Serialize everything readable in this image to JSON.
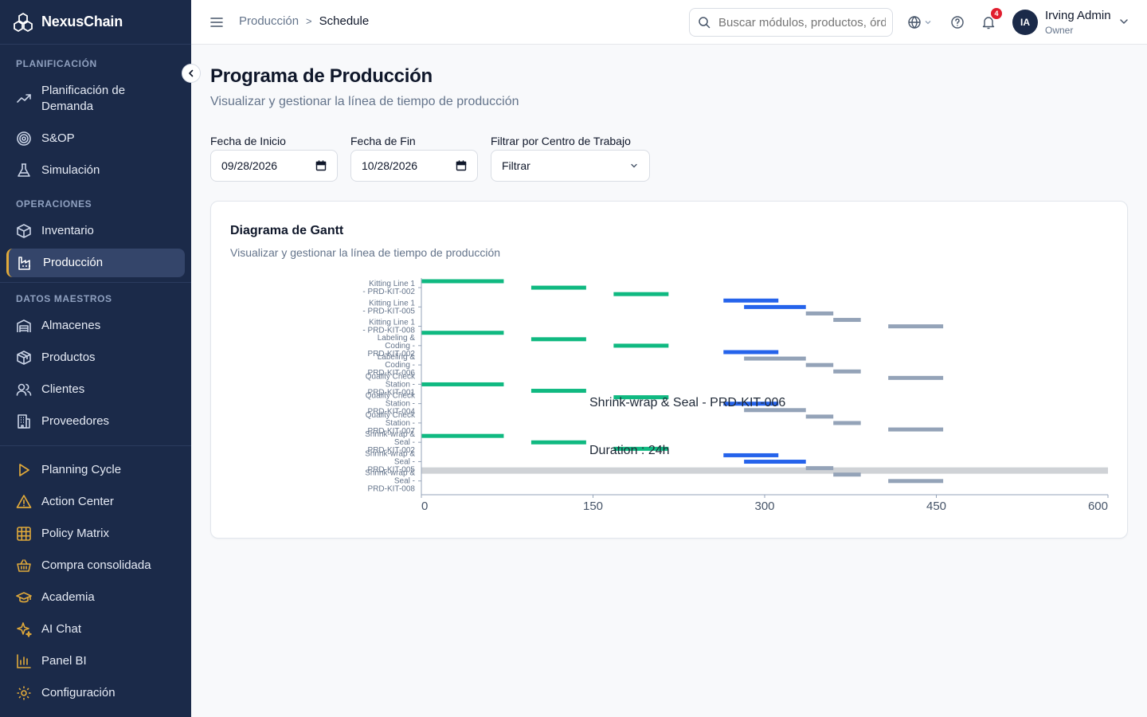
{
  "brand": {
    "name": "NexusChain"
  },
  "sidebar": {
    "sections": {
      "planning": "PLANIFICACIÓN",
      "operations": "OPERACIONES",
      "master_data": "DATOS MAESTROS"
    },
    "items": [
      {
        "label": "Planificación de Demanda",
        "icon": "trend-up-icon"
      },
      {
        "label": "S&OP",
        "icon": "target-icon"
      },
      {
        "label": "Simulación",
        "icon": "flask-icon"
      },
      {
        "label": "Inventario",
        "icon": "box-icon"
      },
      {
        "label": "Producción",
        "icon": "factory-icon",
        "active": true
      },
      {
        "label": "Almacenes",
        "icon": "warehouse-icon"
      },
      {
        "label": "Productos",
        "icon": "package-icon"
      },
      {
        "label": "Clientes",
        "icon": "users-icon"
      },
      {
        "label": "Proveedores",
        "icon": "building-icon"
      },
      {
        "label": "Planning Cycle",
        "icon": "play-icon"
      },
      {
        "label": "Action Center",
        "icon": "alert-triangle-icon"
      },
      {
        "label": "Policy Matrix",
        "icon": "grid-icon"
      },
      {
        "label": "Compra consolidada",
        "icon": "basket-icon"
      },
      {
        "label": "Academia",
        "icon": "graduation-cap-icon"
      },
      {
        "label": "AI Chat",
        "icon": "sparkles-icon"
      },
      {
        "label": "Panel BI",
        "icon": "bar-chart-icon"
      },
      {
        "label": "Configuración",
        "icon": "gear-icon"
      }
    ]
  },
  "topbar": {
    "breadcrumb": {
      "parent": "Producción",
      "separator": ">",
      "current": "Schedule"
    },
    "search": {
      "placeholder": "Buscar módulos, productos, órdenes..."
    },
    "notifications": {
      "count": "4"
    },
    "user": {
      "initials": "IA",
      "name": "Irving Admin",
      "role": "Owner"
    }
  },
  "page": {
    "title": "Programa de Producción",
    "subtitle": "Visualizar y gestionar la línea de tiempo de producción"
  },
  "filters": {
    "start": {
      "label": "Fecha de Inicio",
      "value": "09/28/2026"
    },
    "end": {
      "label": "Fecha de Fin",
      "value": "10/28/2026"
    },
    "work_center": {
      "label": "Filtrar por Centro de Trabajo",
      "value": "Filtrar"
    }
  },
  "card": {
    "title": "Diagrama de Gantt",
    "subtitle": "Visualizar y gestionar la línea de tiempo de producción"
  },
  "colors": {
    "sidebar_bg": "#1b2a49",
    "accent": "#e0a93a",
    "green": "#10b981",
    "blue": "#2563eb",
    "gray": "#94a3b8",
    "badge": "#e11d2e"
  },
  "chart_data": {
    "type": "gantt",
    "x_ticks": [
      0,
      150,
      300,
      450,
      600
    ],
    "xlim": [
      0,
      600
    ],
    "y_categories": [
      "Kitting Line 1 - PRD-KIT-002",
      "Kitting Line 1 - PRD-KIT-005",
      "Kitting Line 1 - PRD-KIT-008",
      "Labeling & Coding - PRD-KIT-002",
      "Labeling & Coding - PRD-KIT-006",
      "Quality Check Station - PRD-KIT-001",
      "Quality Check Station - PRD-KIT-004",
      "Quality Check Station - PRD-KIT-007",
      "Shrink-wrap & Seal - PRD-KIT-002",
      "Shrink-wrap & Seal - PRD-KIT-005",
      "Shrink-wrap & Seal - PRD-KIT-008"
    ],
    "bars": [
      {
        "start": 0,
        "end": 72,
        "row": 0.0,
        "status": "green"
      },
      {
        "start": 96,
        "end": 144,
        "row": 0.32,
        "status": "green"
      },
      {
        "start": 168,
        "end": 216,
        "row": 0.64,
        "status": "green"
      },
      {
        "start": 264,
        "end": 312,
        "row": 0.96,
        "status": "blue"
      },
      {
        "start": 282,
        "end": 336,
        "row": 1.28,
        "status": "blue"
      },
      {
        "start": 336,
        "end": 360,
        "row": 1.6,
        "status": "gray"
      },
      {
        "start": 360,
        "end": 384,
        "row": 1.92,
        "status": "gray"
      },
      {
        "start": 408,
        "end": 456,
        "row": 2.24,
        "status": "gray"
      },
      {
        "start": 0,
        "end": 72,
        "row": 2.56,
        "status": "green"
      },
      {
        "start": 96,
        "end": 144,
        "row": 2.88,
        "status": "green"
      },
      {
        "start": 168,
        "end": 216,
        "row": 3.2,
        "status": "green"
      },
      {
        "start": 264,
        "end": 312,
        "row": 3.52,
        "status": "blue"
      },
      {
        "start": 282,
        "end": 336,
        "row": 3.84,
        "status": "gray"
      },
      {
        "start": 336,
        "end": 360,
        "row": 4.16,
        "status": "gray"
      },
      {
        "start": 360,
        "end": 384,
        "row": 4.48,
        "status": "gray"
      },
      {
        "start": 408,
        "end": 456,
        "row": 4.8,
        "status": "gray"
      },
      {
        "start": 0,
        "end": 72,
        "row": 5.12,
        "status": "green"
      },
      {
        "start": 96,
        "end": 144,
        "row": 5.44,
        "status": "green"
      },
      {
        "start": 168,
        "end": 216,
        "row": 5.76,
        "status": "green"
      },
      {
        "start": 264,
        "end": 312,
        "row": 6.08,
        "status": "blue"
      },
      {
        "start": 282,
        "end": 336,
        "row": 6.4,
        "status": "gray"
      },
      {
        "start": 336,
        "end": 360,
        "row": 6.72,
        "status": "gray"
      },
      {
        "start": 360,
        "end": 384,
        "row": 7.04,
        "status": "gray"
      },
      {
        "start": 408,
        "end": 456,
        "row": 7.36,
        "status": "gray"
      },
      {
        "start": 0,
        "end": 72,
        "row": 7.68,
        "status": "green"
      },
      {
        "start": 96,
        "end": 144,
        "row": 8.0,
        "status": "green"
      },
      {
        "start": 168,
        "end": 216,
        "row": 8.32,
        "status": "green"
      },
      {
        "start": 264,
        "end": 312,
        "row": 8.64,
        "status": "blue"
      },
      {
        "start": 282,
        "end": 336,
        "row": 8.96,
        "status": "blue"
      },
      {
        "start": 336,
        "end": 360,
        "row": 9.28,
        "status": "gray"
      },
      {
        "start": 360,
        "end": 384,
        "row": 9.6,
        "status": "gray"
      },
      {
        "start": 408,
        "end": 456,
        "row": 9.92,
        "status": "gray"
      }
    ],
    "hover_row": 9.4,
    "tooltip": {
      "name": "Shrink-wrap & Seal - PRD-KIT-006",
      "detail": "Duration : 24h"
    }
  }
}
